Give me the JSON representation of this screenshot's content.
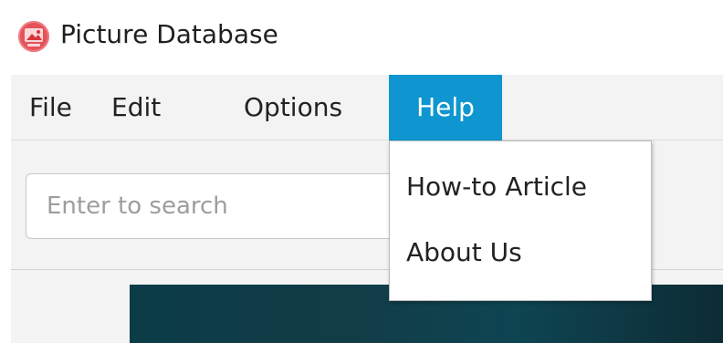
{
  "window": {
    "title": "Picture Database",
    "icon": "picture-app-icon"
  },
  "menubar": {
    "items": [
      {
        "label": "File"
      },
      {
        "label": "Edit"
      },
      {
        "label": "Options"
      },
      {
        "label": "Help"
      }
    ],
    "active_color": "#0f96d0"
  },
  "search": {
    "placeholder": "Enter to search",
    "value": ""
  },
  "help_menu": {
    "items": [
      {
        "label": "How-to Article"
      },
      {
        "label": "About Us"
      }
    ]
  },
  "colors": {
    "menu_background": "#f3f3f3",
    "menu_selection": "#0f96d0",
    "preview_background": "#0b3c48",
    "app_icon": "#e4535a"
  }
}
